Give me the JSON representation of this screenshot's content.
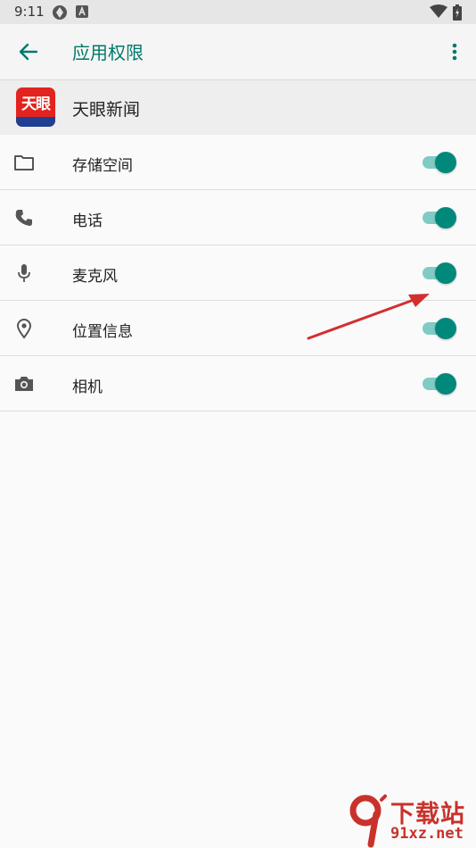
{
  "status_bar": {
    "time": "9:11"
  },
  "app_bar": {
    "title": "应用权限"
  },
  "app": {
    "name": "天眼新闻",
    "icon_text": "天眼"
  },
  "permissions": [
    {
      "label": "存储空间",
      "icon": "folder-icon",
      "enabled": true
    },
    {
      "label": "电话",
      "icon": "phone-icon",
      "enabled": true
    },
    {
      "label": "麦克风",
      "icon": "microphone-icon",
      "enabled": true
    },
    {
      "label": "位置信息",
      "icon": "location-pin-icon",
      "enabled": true
    },
    {
      "label": "相机",
      "icon": "camera-icon",
      "enabled": true
    }
  ],
  "watermark": {
    "title": "下载站",
    "url": "91xz.net"
  },
  "colors": {
    "accent": "#00796b",
    "toggle_thumb": "#00897b",
    "toggle_track": "#80cbc4",
    "annotation_arrow": "#d32f2f",
    "watermark": "#c8322b"
  }
}
